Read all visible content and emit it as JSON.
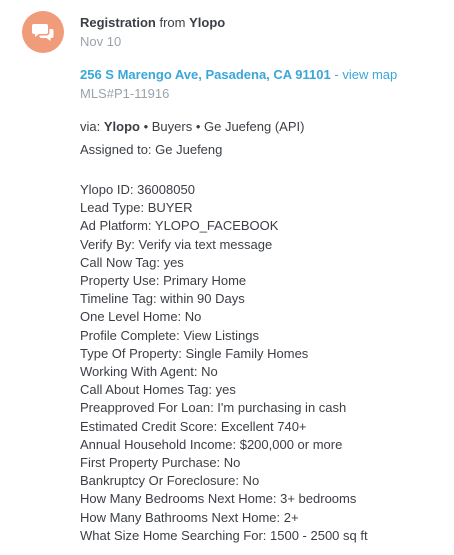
{
  "event": {
    "title_bold": "Registration",
    "title_from": "from",
    "source": "Ylopo",
    "date": "Nov 10",
    "address": "256 S Marengo Ave, Pasadena, CA 91101",
    "address_separator": "-",
    "view_map": "view map",
    "mls": "MLS#P1-11916",
    "via_label": "via:",
    "via_source": "Ylopo",
    "via_rest": "• Buyers • Ge Juefeng (API)",
    "assigned": "Assigned to: Ge Juefeng",
    "icon": "chat-bubbles-icon",
    "accent_color": "#3aa7d9",
    "avatar_color": "#f09b7a"
  },
  "details": [
    "Ylopo ID: 36008050",
    "Lead Type: BUYER",
    "Ad Platform: YLOPO_FACEBOOK",
    "Verify By: Verify via text message",
    "Call Now Tag: yes",
    "Property Use: Primary Home",
    "Timeline Tag: within 90 Days",
    "One Level Home: No",
    "Profile Complete: View Listings",
    "Type Of Property: Single Family Homes",
    "Working With Agent: No",
    "Call About Homes Tag: yes",
    "Preapproved For Loan: I'm purchasing in cash",
    "Estimated Credit Score: Excellent 740+",
    "Annual Household Income: $200,000 or more",
    "First Property Purchase: No",
    "Bankruptcy Or Foreclosure: No",
    "How Many Bedrooms Next Home: 3+ bedrooms",
    "How Many Bathrooms Next Home: 2+",
    "What Size Home Searching For: 1500 - 2500 sq ft"
  ]
}
